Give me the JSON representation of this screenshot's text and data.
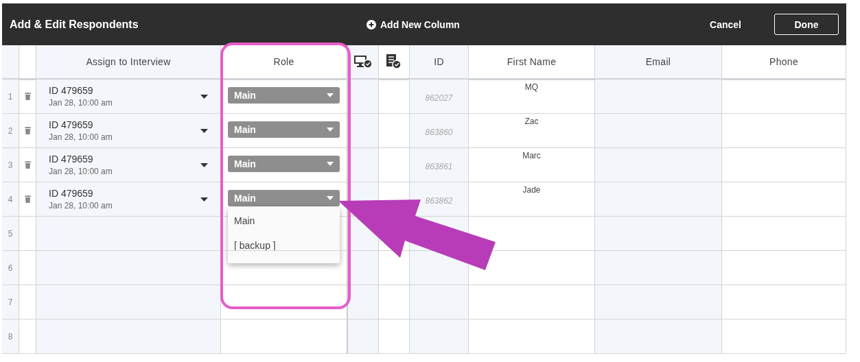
{
  "header": {
    "title": "Add & Edit Respondents",
    "add_column": "Add New Column",
    "cancel": "Cancel",
    "done": "Done"
  },
  "columns": [
    {
      "kind": "number"
    },
    {
      "kind": "trash"
    },
    {
      "kind": "assign",
      "label": "Assign to Interview"
    },
    {
      "kind": "role",
      "label": "Role"
    },
    {
      "kind": "monitor"
    },
    {
      "kind": "list"
    },
    {
      "kind": "id",
      "label": "ID"
    },
    {
      "kind": "first_name",
      "label": "First Name"
    },
    {
      "kind": "email",
      "label": "Email"
    },
    {
      "kind": "phone",
      "label": "Phone"
    }
  ],
  "role_options": [
    "Main",
    "[ backup ]"
  ],
  "rows": [
    {
      "number": "1",
      "interview": "ID 479659",
      "date": "Jan 28, 10:00 am",
      "role": "Main",
      "menu_open": false,
      "id": "862027",
      "first_name": "MQ"
    },
    {
      "number": "2",
      "interview": "ID 479659",
      "date": "Jan 28, 10:00 am",
      "role": "Main",
      "menu_open": false,
      "id": "863860",
      "first_name": "Zac"
    },
    {
      "number": "3",
      "interview": "ID 479659",
      "date": "Jan 28, 10:00 am",
      "role": "Main",
      "menu_open": false,
      "id": "863861",
      "first_name": "Marc"
    },
    {
      "number": "4",
      "interview": "ID 479659",
      "date": "Jan 28, 10:00 am",
      "role": "Main",
      "menu_open": true,
      "id": "863862",
      "first_name": "Jade"
    },
    {
      "number": "5"
    },
    {
      "number": "6"
    },
    {
      "number": "7"
    },
    {
      "number": "8"
    }
  ],
  "annotations": [
    {
      "kind": "highlight"
    },
    {
      "kind": "arrow"
    }
  ]
}
